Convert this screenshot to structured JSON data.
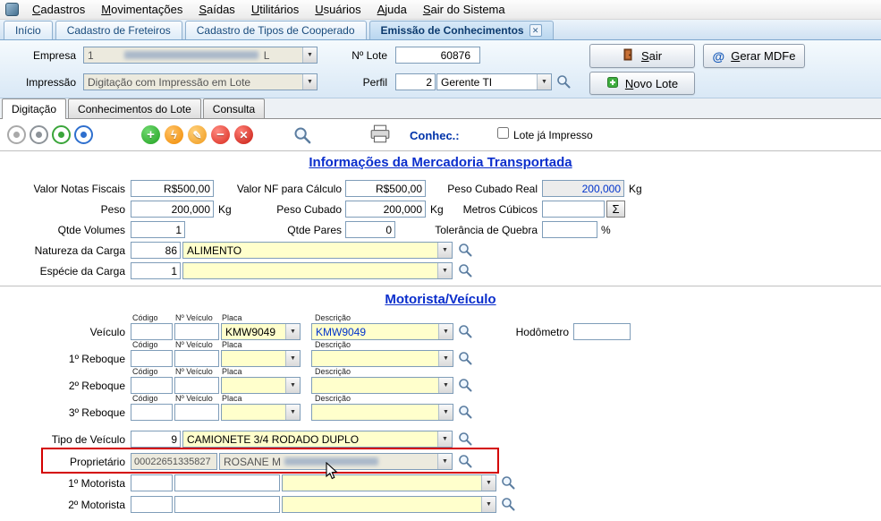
{
  "menu": {
    "items": [
      "Cadastros",
      "Movimentações",
      "Saídas",
      "Utilitários",
      "Usuários",
      "Ajuda",
      "Sair do Sistema"
    ]
  },
  "tabs": {
    "items": [
      "Início",
      "Cadastro de Freteiros",
      "Cadastro de Tipos de Cooperado",
      "Emissão de Conhecimentos"
    ]
  },
  "icons": {
    "dropdown": "▼",
    "add": "+",
    "lightning": "ϟ",
    "edit": "✎",
    "delete": "−",
    "cancel": "✕",
    "close": "✕",
    "sigma": "Σ",
    "at": "@"
  },
  "header": {
    "empresa_label": "Empresa",
    "empresa_code": "1",
    "empresa_suffix": "L",
    "lote_label": "Nº Lote",
    "lote_value": "60876",
    "impressao_label": "Impressão",
    "impressao_value": "Digitação com Impressão em Lote",
    "perfil_label": "Perfil",
    "perfil_code": "2",
    "perfil_value": "Gerente TI",
    "buttons": {
      "sair": "Sair",
      "gerar_mdfe": "Gerar MDFe",
      "novo_lote": "Novo Lote"
    }
  },
  "subtabs": {
    "items": [
      "Digitação",
      "Conhecimentos do Lote",
      "Consulta"
    ]
  },
  "toolbar": {
    "conhec_label": "Conhec.:",
    "lote_impresso_label": "Lote já Impresso",
    "lote_impresso_checked": false
  },
  "mercadoria": {
    "title": "Informações da Mercadoria Transportada",
    "valor_notas_fiscais_label": "Valor Notas Fiscais",
    "valor_notas_fiscais": "R$500,00",
    "valor_nf_calculo_label": "Valor NF para Cálculo",
    "valor_nf_calculo": "R$500,00",
    "peso_cubado_real_label": "Peso Cubado Real",
    "peso_cubado_real": "200,000",
    "peso_cubado_real_unit": "Kg",
    "peso_label": "Peso",
    "peso": "200,000",
    "peso_unit": "Kg",
    "peso_cubado_label": "Peso Cubado",
    "peso_cubado": "200,000",
    "peso_cubado_unit": "Kg",
    "metros_cubicos_label": "Metros Cúbicos",
    "metros_cubicos": "",
    "qtde_volumes_label": "Qtde Volumes",
    "qtde_volumes": "1",
    "qtde_pares_label": "Qtde Pares",
    "qtde_pares": "0",
    "tolerancia_label": "Tolerância de Quebra",
    "tolerancia": "",
    "tolerancia_unit": "%",
    "natureza_label": "Natureza da Carga",
    "natureza_code": "86",
    "natureza_desc": "ALIMENTO",
    "especie_label": "Espécie da Carga",
    "especie_code": "1",
    "especie_desc": ""
  },
  "vehicle": {
    "title": "Motorista/Veículo",
    "columns": {
      "codigo": "Código",
      "nveiculo": "Nº Veículo",
      "placa": "Placa",
      "descricao": "Descrição"
    },
    "rows": [
      {
        "label": "Veículo",
        "codigo": "",
        "nveiculo": "",
        "placa": "KMW9049",
        "descricao": "KMW9049"
      },
      {
        "label": "1º Reboque",
        "codigo": "",
        "nveiculo": "",
        "placa": "",
        "descricao": ""
      },
      {
        "label": "2º Reboque",
        "codigo": "",
        "nveiculo": "",
        "placa": "",
        "descricao": ""
      },
      {
        "label": "3º Reboque",
        "codigo": "",
        "nveiculo": "",
        "placa": "",
        "descricao": ""
      }
    ],
    "hodometro_label": "Hodômetro",
    "hodometro": "",
    "tipo_label": "Tipo de Veículo",
    "tipo_code": "9",
    "tipo_desc": "CAMIONETE 3/4 RODADO DUPLO",
    "proprietario_label": "Proprietário",
    "proprietario_code": "00022651335827",
    "proprietario_desc": "ROSANE M",
    "motorista1_label": "1º Motorista",
    "motorista1_codigo": "",
    "motorista1_doc": "",
    "motorista1_desc": "",
    "motorista2_label": "2º Motorista",
    "motorista2_codigo": "",
    "motorista2_doc": "",
    "motorista2_desc": ""
  }
}
